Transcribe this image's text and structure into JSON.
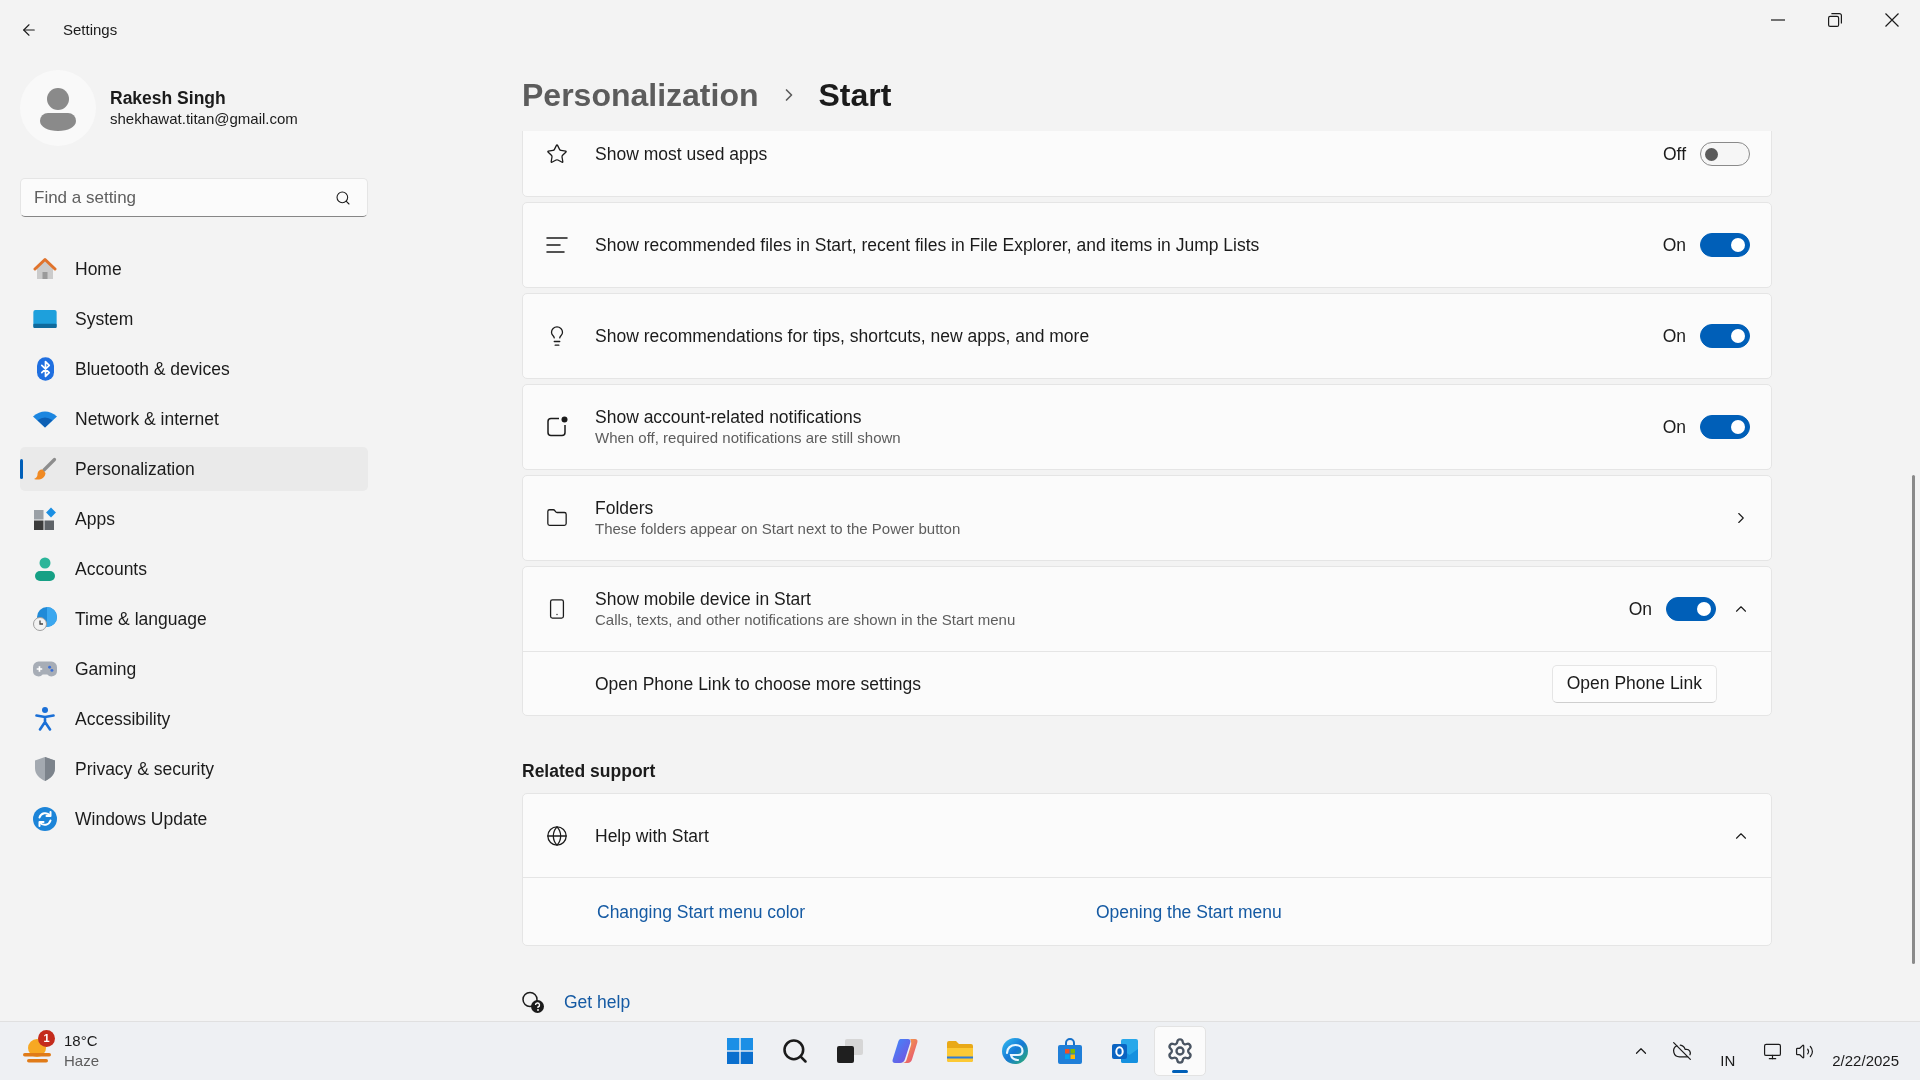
{
  "window": {
    "title": "Settings"
  },
  "profile": {
    "name": "Rakesh Singh",
    "email": "shekhawat.titan@gmail.com"
  },
  "search": {
    "placeholder": "Find a setting"
  },
  "sidebar": {
    "items": [
      {
        "label": "Home",
        "selected": false
      },
      {
        "label": "System",
        "selected": false
      },
      {
        "label": "Bluetooth & devices",
        "selected": false
      },
      {
        "label": "Network & internet",
        "selected": false
      },
      {
        "label": "Personalization",
        "selected": true
      },
      {
        "label": "Apps",
        "selected": false
      },
      {
        "label": "Accounts",
        "selected": false
      },
      {
        "label": "Time & language",
        "selected": false
      },
      {
        "label": "Gaming",
        "selected": false
      },
      {
        "label": "Accessibility",
        "selected": false
      },
      {
        "label": "Privacy & security",
        "selected": false
      },
      {
        "label": "Windows Update",
        "selected": false
      }
    ]
  },
  "breadcrumb": [
    {
      "label": "Personalization",
      "current": false
    },
    {
      "label": "Start",
      "current": true
    }
  ],
  "settings": [
    {
      "kind": "toggle",
      "title": "Show most used apps",
      "on": false,
      "state_label": "Off"
    },
    {
      "kind": "toggle",
      "title": "Show recommended files in Start, recent files in File Explorer, and items in Jump Lists",
      "on": true,
      "state_label": "On"
    },
    {
      "kind": "toggle",
      "title": "Show recommendations for tips, shortcuts, new apps, and more",
      "on": true,
      "state_label": "On"
    },
    {
      "kind": "toggle",
      "title": "Show account-related notifications",
      "description": "When off, required notifications are still shown",
      "on": true,
      "state_label": "On"
    },
    {
      "kind": "link",
      "title": "Folders",
      "description": "These folders appear on Start next to the Power button"
    },
    {
      "kind": "expander",
      "title": "Show mobile device in Start",
      "description": "Calls, texts, and other notifications are shown in the Start menu",
      "on": true,
      "state_label": "On",
      "expanded": true,
      "detail": {
        "text": "Open Phone Link to choose more settings",
        "button": "Open Phone Link"
      }
    }
  ],
  "related_support": {
    "heading": "Related support",
    "title": "Help with Start",
    "expanded": true,
    "links": [
      "Changing Start menu color",
      "Opening the Start menu"
    ]
  },
  "get_help": {
    "label": "Get help"
  },
  "taskbar": {
    "weather": {
      "badge": "1",
      "temperature": "18°C",
      "condition": "Haze"
    },
    "apps": [
      {
        "selected": false
      },
      {
        "selected": false
      },
      {
        "selected": false
      },
      {
        "selected": false
      },
      {
        "selected": false
      },
      {
        "selected": false
      },
      {
        "selected": false
      },
      {
        "selected": false
      },
      {
        "selected": true
      }
    ],
    "tray": {
      "language": "IN",
      "date": "2/22/2025"
    }
  }
}
